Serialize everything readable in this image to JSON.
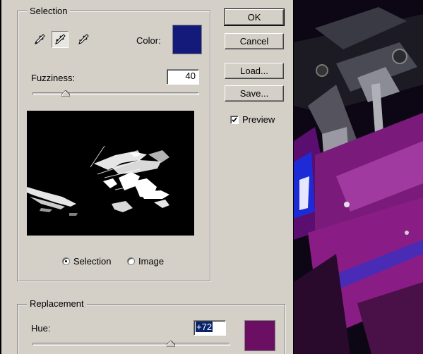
{
  "selection": {
    "group_title": "Selection",
    "color_label": "Color:",
    "color_value": "#141a7a",
    "fuzziness_label": "Fuzziness:",
    "fuzziness_value": "40",
    "fuzziness_level": 0.2,
    "view_options": [
      {
        "label": "Selection",
        "selected": true
      },
      {
        "label": "Image",
        "selected": false
      }
    ]
  },
  "buttons": {
    "ok": "OK",
    "cancel": "Cancel",
    "load": "Load...",
    "save": "Save..."
  },
  "preview_checkbox": {
    "label": "Preview",
    "checked": true
  },
  "replacement": {
    "group_title": "Replacement",
    "hue_label": "Hue:",
    "hue_value": "+72",
    "hue_level": 0.7,
    "swatch_color": "#6b0f63"
  },
  "icons": [
    "eyedropper-icon",
    "eyedropper-plus-icon",
    "eyedropper-minus-icon"
  ]
}
